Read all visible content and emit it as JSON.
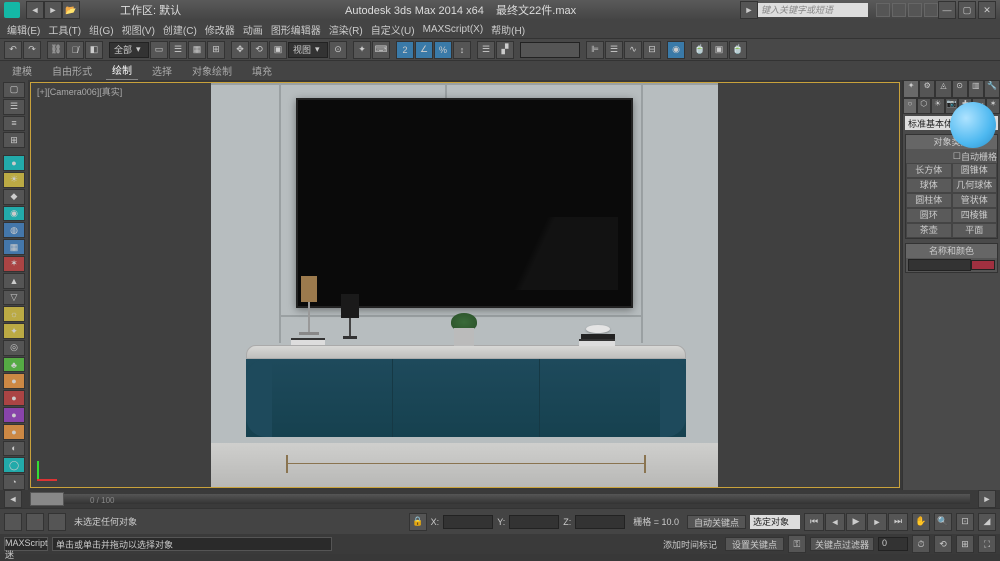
{
  "titlebar": {
    "workspace_label": "工作区: 默认",
    "app_title": "Autodesk 3ds Max  2014 x64",
    "filename": "最终文22件.max",
    "search_placeholder": "键入关键字或短语"
  },
  "menubar": {
    "items": [
      "编辑(E)",
      "工具(T)",
      "组(G)",
      "视图(V)",
      "创建(C)",
      "修改器",
      "动画",
      "图形编辑器",
      "渲染(R)",
      "自定义(U)",
      "MAXScript(X)",
      "帮助(H)"
    ]
  },
  "toolbar1": {
    "selection_filter": "全部",
    "view_combo": "视图"
  },
  "tabbar": {
    "items": [
      "建模",
      "自由形式",
      "绘制",
      "选择",
      "对象绘制",
      "填充"
    ],
    "active": 2
  },
  "viewport": {
    "label": "[+][Camera006][真实]",
    "frame_range": "0 / 100"
  },
  "right_panel": {
    "category": "标准基本体",
    "section_type": "对象类型",
    "autogrid": "自动栅格",
    "primitives": [
      [
        "长方体",
        "圆锥体"
      ],
      [
        "球体",
        "几何球体"
      ],
      [
        "圆柱体",
        "管状体"
      ],
      [
        "圆环",
        "四棱锥"
      ],
      [
        "茶壶",
        "平面"
      ]
    ],
    "section_color": "名称和颜色"
  },
  "statusbar": {
    "selection": "未选定任何对象",
    "grid_label": "栅格 = 10.0",
    "autokey": "自动关键点",
    "selected_combo": "选定对象",
    "setkey": "设置关键点",
    "keyfilter": "关键点过滤器"
  },
  "statusbar2": {
    "script_hint": "MAXScript 迷",
    "script_tip": "单击或单击并拖动以选择对象",
    "addtime": "添加时间标记"
  }
}
